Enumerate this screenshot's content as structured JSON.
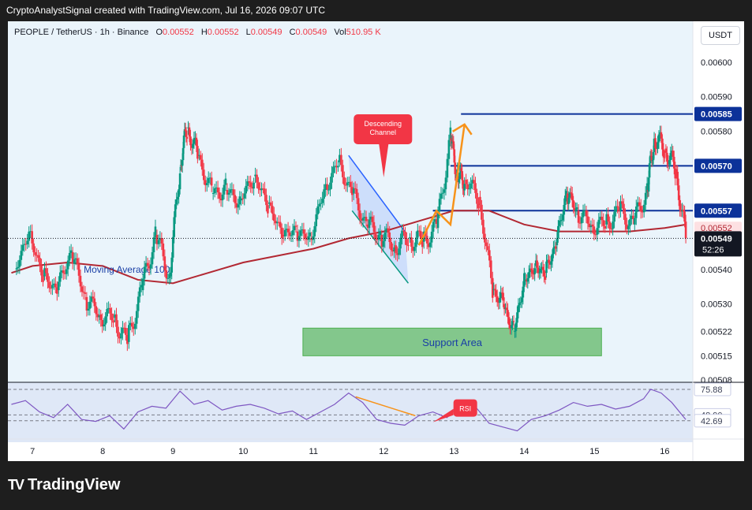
{
  "header": {
    "attribution": "CryptoAnalystSignal created with TradingView.com, Jul 16, 2026 09:07 UTC"
  },
  "legend": {
    "symbol": "PEOPLE / TetherUS · 1h · Binance",
    "o_label": "O",
    "o_value": "0.00552",
    "h_label": "H",
    "h_value": "0.00552",
    "l_label": "L",
    "l_value": "0.00549",
    "c_label": "C",
    "c_value": "0.00549",
    "vol_label": "Vol",
    "vol_value": "510.95 K"
  },
  "currency_button": "USDT",
  "brand": {
    "name": "TradingView",
    "mark": "TV"
  },
  "colors": {
    "up": "#089981",
    "down": "#f23645",
    "ma": "#b22833",
    "level": "#0c3299",
    "support": "#4caf50",
    "channel": "#2962ff",
    "arrow": "#f7931a",
    "rsi": "#7e57c2",
    "callout": "#f23645"
  },
  "chart_data": [
    {
      "type": "candlestick",
      "title": "PEOPLE / TetherUS · 1h · Binance",
      "x_tick_labels": [
        "7",
        "8",
        "9",
        "10",
        "11",
        "12",
        "13",
        "14",
        "15",
        "16"
      ],
      "y_tick_labels": [
        "0.00600",
        "0.00590",
        "0.00580",
        "0.00540",
        "0.00530",
        "0.00522",
        "0.00515",
        "0.00508"
      ],
      "ylim": [
        0.00508,
        0.00605
      ],
      "grid": false,
      "price_series": {
        "name": "",
        "x": [
          6.75,
          6.95,
          7.15,
          7.35,
          7.55,
          7.75,
          7.95,
          8.15,
          8.35,
          8.55,
          8.75,
          8.95,
          9.1,
          9.2,
          9.35,
          9.55,
          9.75,
          9.95,
          10.15,
          10.35,
          10.55,
          10.75,
          10.95,
          11.15,
          11.35,
          11.55,
          11.75,
          11.95,
          12.15,
          12.35,
          12.55,
          12.75,
          12.95,
          13.05,
          13.15,
          13.35,
          13.55,
          13.7,
          13.85,
          14.0,
          14.15,
          14.3,
          14.45,
          14.6,
          14.75,
          14.95,
          15.15,
          15.35,
          15.55,
          15.75,
          15.85,
          16.0,
          16.15,
          16.3
        ],
        "y": [
          0.0054,
          0.00551,
          0.00538,
          0.00534,
          0.00545,
          0.00532,
          0.00527,
          0.00526,
          0.00519,
          0.00534,
          0.0055,
          0.00538,
          0.0057,
          0.00581,
          0.00573,
          0.00562,
          0.00563,
          0.0056,
          0.00567,
          0.00559,
          0.0055,
          0.00551,
          0.00549,
          0.00563,
          0.00571,
          0.00562,
          0.00553,
          0.0055,
          0.00547,
          0.00549,
          0.00548,
          0.00552,
          0.00578,
          0.00567,
          0.00566,
          0.00561,
          0.00534,
          0.0053,
          0.00522,
          0.00537,
          0.00541,
          0.00539,
          0.00547,
          0.00562,
          0.00557,
          0.00553,
          0.00553,
          0.00557,
          0.00553,
          0.00563,
          0.00578,
          0.00575,
          0.00569,
          0.00549
        ]
      },
      "moving_average_100": {
        "name": "Moving Average 100",
        "x": [
          6.7,
          7.0,
          7.5,
          8.0,
          8.5,
          9.0,
          9.5,
          10.0,
          10.5,
          11.0,
          11.5,
          12.0,
          12.5,
          13.0,
          13.5,
          14.0,
          14.5,
          15.0,
          15.5,
          16.0,
          16.3
        ],
        "y": [
          0.00539,
          0.00541,
          0.00542,
          0.00541,
          0.00537,
          0.00536,
          0.00539,
          0.00542,
          0.00544,
          0.00546,
          0.00549,
          0.00551,
          0.00554,
          0.00557,
          0.00557,
          0.00553,
          0.00551,
          0.00551,
          0.00551,
          0.00552,
          0.00553
        ]
      },
      "levels": [
        {
          "label": "0.00585",
          "value": 0.00585,
          "from_x": 13.1
        },
        {
          "label": "0.00570",
          "value": 0.0057,
          "from_x": 12.95
        },
        {
          "label": "0.00557",
          "value": 0.00557,
          "from_x": 12.7
        }
      ],
      "last_price_label": "0.00549",
      "countdown_label": "52:26",
      "ma_price_label": "0.00552",
      "support_area": {
        "label": "Support Area",
        "x_from": 10.85,
        "x_to": 15.1,
        "y_low": 0.00515,
        "y_high": 0.00523
      },
      "descending_channel": {
        "label": "Descending Channel",
        "upper": [
          [
            11.5,
            0.00573
          ],
          [
            12.3,
            0.00551
          ]
        ],
        "lower": [
          [
            11.55,
            0.00557
          ],
          [
            12.35,
            0.00536
          ]
        ]
      },
      "orange_path": [
        [
          12.5,
          0.00547
        ],
        [
          12.75,
          0.00557
        ],
        [
          12.95,
          0.00553
        ],
        [
          13.15,
          0.00582
        ]
      ],
      "annotations": [
        "Moving Average 100",
        "Support Area",
        "Descending Channel",
        "RSI"
      ]
    },
    {
      "type": "line",
      "name": "RSI",
      "y_tick_labels": [
        "75.88",
        "48.90",
        "42.69"
      ],
      "ylim": [
        25,
        80
      ],
      "x": [
        6.7,
        6.9,
        7.1,
        7.3,
        7.5,
        7.7,
        7.9,
        8.1,
        8.3,
        8.5,
        8.7,
        8.9,
        9.1,
        9.3,
        9.5,
        9.7,
        9.9,
        10.1,
        10.3,
        10.5,
        10.7,
        10.9,
        11.1,
        11.3,
        11.5,
        11.7,
        11.9,
        12.1,
        12.3,
        12.5,
        12.7,
        12.9,
        13.1,
        13.3,
        13.5,
        13.7,
        13.9,
        14.1,
        14.3,
        14.5,
        14.7,
        14.9,
        15.1,
        15.3,
        15.5,
        15.7,
        15.8,
        15.95,
        16.1,
        16.3
      ],
      "y": [
        60,
        64,
        52,
        46,
        60,
        44,
        42,
        48,
        34,
        52,
        58,
        56,
        74,
        60,
        64,
        54,
        58,
        60,
        56,
        50,
        53,
        44,
        52,
        60,
        72,
        62,
        44,
        40,
        38,
        48,
        52,
        46,
        60,
        58,
        40,
        36,
        32,
        44,
        48,
        54,
        62,
        58,
        60,
        55,
        58,
        66,
        76,
        72,
        62,
        44
      ],
      "trend_line": [
        [
          11.6,
          68
        ],
        [
          12.45,
          48
        ]
      ],
      "levels": [
        {
          "label": "75.88",
          "value": 75.88
        },
        {
          "label": "48.90",
          "value": 48.9
        },
        {
          "label": "42.69",
          "value": 42.69
        }
      ]
    }
  ]
}
